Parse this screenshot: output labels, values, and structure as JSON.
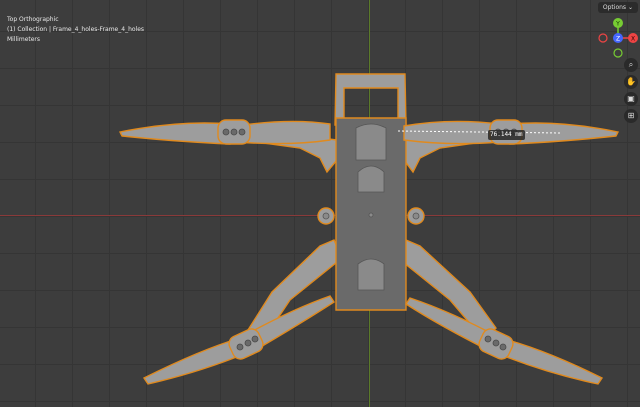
{
  "viewport": {
    "view_name": "Top Orthographic",
    "collection_info": "(1) Collection | Frame_4_holes-Frame_4_holes",
    "units": "Millimeters"
  },
  "header": {
    "options_label": "Options"
  },
  "gizmo": {
    "x_label": "X",
    "y_label": "Y",
    "z_label": "Z"
  },
  "nav_icons": [
    "zoom-icon",
    "hand-icon",
    "camera-icon",
    "grid-icon"
  ],
  "measurement": {
    "value": "76.144 mm"
  },
  "colors": {
    "background": "#3d3d3d",
    "grid": "#353535",
    "x_axis": "#8a3a3a",
    "y_axis": "#5b7a2a",
    "selection_outline": "#e08a1e",
    "mesh": "#9d9d9d",
    "mesh_dark": "#5a5a5a"
  }
}
